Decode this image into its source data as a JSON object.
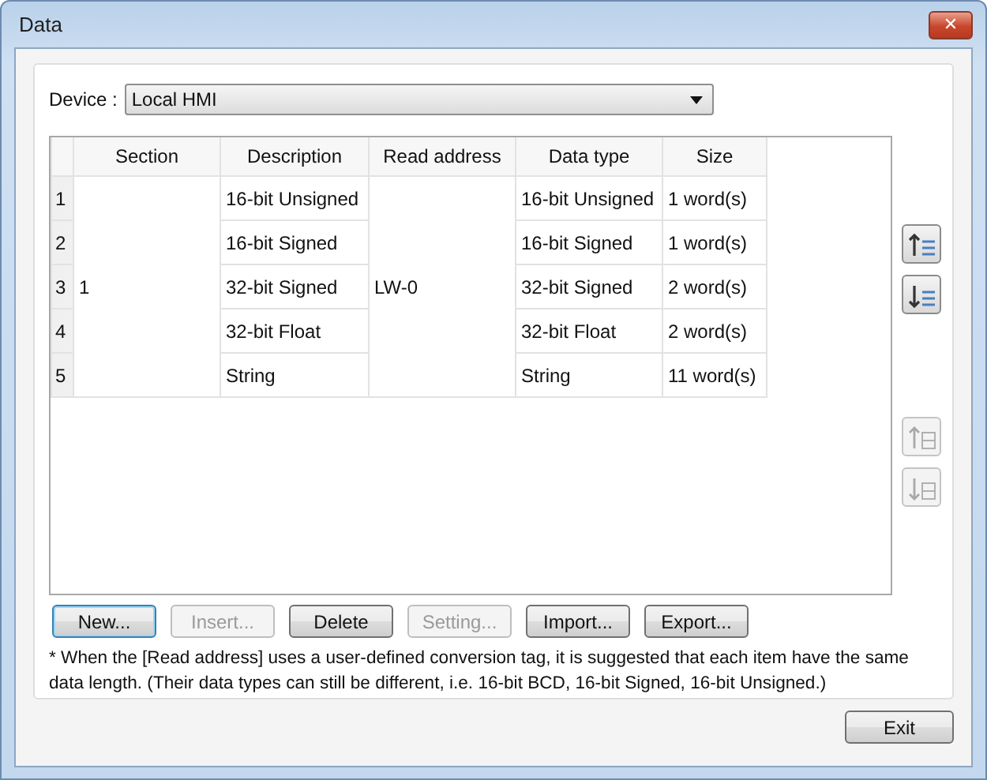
{
  "window": {
    "title": "Data",
    "close_label": "✕"
  },
  "device": {
    "label": "Device :",
    "value": "Local HMI"
  },
  "table": {
    "columns": [
      "Section",
      "Description",
      "Read address",
      "Data type",
      "Size"
    ],
    "groups": [
      {
        "section": "1",
        "read_address": "LW-0",
        "rows": [
          {
            "number": "1",
            "description": "16-bit Unsigned",
            "data_type": "16-bit Unsigned",
            "size": "1 word(s)"
          },
          {
            "number": "2",
            "description": "16-bit Signed",
            "data_type": "16-bit Signed",
            "size": "1 word(s)"
          },
          {
            "number": "3",
            "description": "32-bit Signed",
            "data_type": "32-bit Signed",
            "size": "2 word(s)"
          },
          {
            "number": "4",
            "description": "32-bit Float",
            "data_type": "32-bit Float",
            "size": "2 word(s)"
          },
          {
            "number": "5",
            "description": "String",
            "data_type": "String",
            "size": "11 word(s)"
          }
        ]
      }
    ]
  },
  "side_buttons": [
    {
      "kind": "up",
      "disabled": false
    },
    {
      "kind": "down",
      "disabled": false
    },
    {
      "kind": "top",
      "disabled": true
    },
    {
      "kind": "bottom",
      "disabled": true
    }
  ],
  "buttons": [
    {
      "label": "New...",
      "disabled": false,
      "focused": true
    },
    {
      "label": "Insert...",
      "disabled": true,
      "focused": false
    },
    {
      "label": "Delete",
      "disabled": false,
      "focused": false
    },
    {
      "label": "Setting...",
      "disabled": true,
      "focused": false
    },
    {
      "label": "Import...",
      "disabled": false,
      "focused": false
    },
    {
      "label": "Export...",
      "disabled": false,
      "focused": false
    }
  ],
  "note": "* When the [Read address] uses a user-defined conversion tag, it is suggested that each item have the same data length. (Their data types can still be different, i.e. 16-bit BCD, 16-bit Signed, 16-bit Unsigned.)",
  "exit_button": {
    "label": "Exit"
  }
}
